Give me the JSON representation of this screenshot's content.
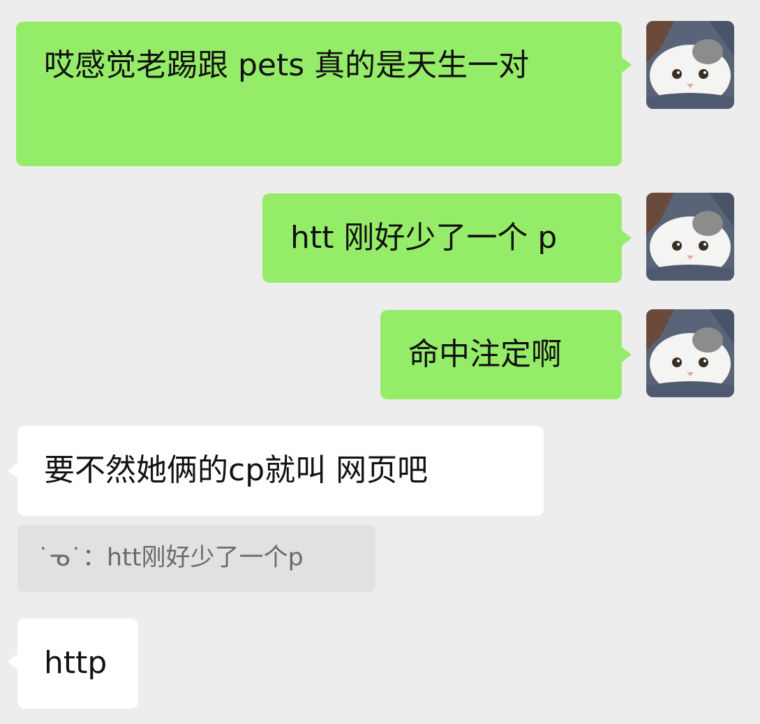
{
  "messages": [
    {
      "side": "sent",
      "text": "哎感觉老踢跟 pets 真的是天生一对"
    },
    {
      "side": "sent",
      "text": "htt 刚好少了一个 p"
    },
    {
      "side": "sent",
      "text": "命中注定啊"
    },
    {
      "side": "received",
      "text": "要不然她俩的cp就叫 网页吧"
    },
    {
      "side": "received",
      "text": "http"
    }
  ],
  "quote": {
    "sender": "˙ᓀ˙",
    "separator": "：",
    "text": "htt刚好少了一个p"
  },
  "avatar": {
    "description": "cat-avatar"
  },
  "colors": {
    "background": "#ededed",
    "sent_bubble": "#95ec69",
    "received_bubble": "#ffffff",
    "quote_bg": "#e1e1e1"
  }
}
